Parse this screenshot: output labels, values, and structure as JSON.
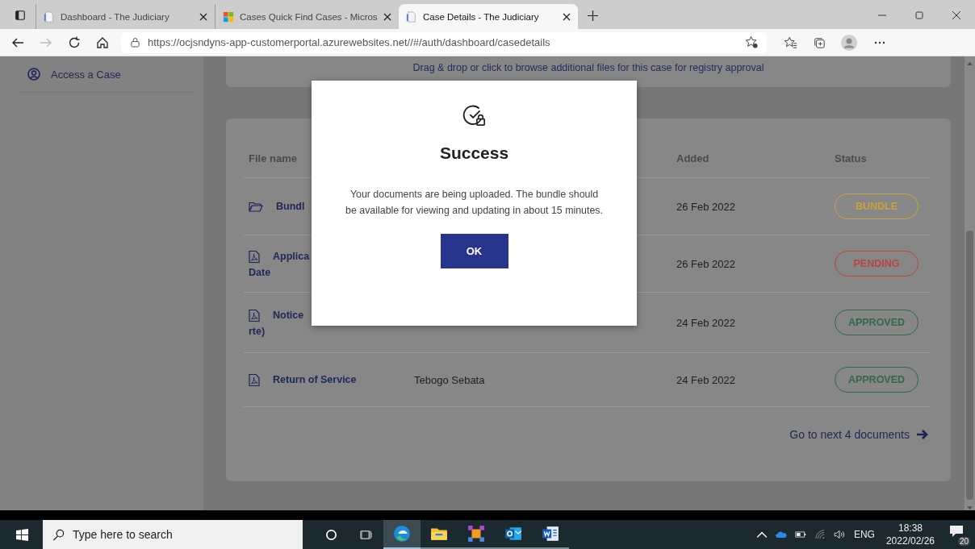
{
  "browser": {
    "tabs": [
      {
        "title": "Dashboard - The Judiciary",
        "kind": "page",
        "selected": false
      },
      {
        "title": "Cases Quick Find Cases - Micros",
        "kind": "windows",
        "selected": false
      },
      {
        "title": "Case Details - The Judiciary",
        "kind": "page",
        "selected": true
      }
    ],
    "forward_disabled": true,
    "address": "https://ocjsndyns-app-customerportal.azurewebsites.net//#/auth/dashboard/casedetails"
  },
  "sidebar": {
    "items": [
      {
        "label": "Access a Case"
      }
    ]
  },
  "upload_card": {
    "text": "Drag & drop or click to browse additional files for this case for registry approval"
  },
  "documents": {
    "columns": [
      {
        "label": "File name"
      },
      {
        "label": "Added"
      },
      {
        "label": "Status"
      }
    ],
    "rows": [
      {
        "kind": "folder",
        "name_lines": [
          "Bundl"
        ],
        "added": "26 Feb 2022",
        "status": "BUNDLE",
        "color": "#c9a43c"
      },
      {
        "kind": "pdf",
        "name_lines": [
          "Applica",
          "Date"
        ],
        "added": "26 Feb 2022",
        "status": "PENDING",
        "color": "#b8443c"
      },
      {
        "kind": "pdf",
        "name_lines": [
          "Notice",
          "rte)"
        ],
        "added": "24 Feb 2022",
        "status": "APPROVED",
        "color": "#2f6a48"
      },
      {
        "kind": "pdf",
        "name_lines": [
          "Return of Service"
        ],
        "uploaded_by": "Tebogo Sebata",
        "added": "24 Feb 2022",
        "status": "APPROVED",
        "color": "#2f6a48"
      }
    ],
    "next_link": "Go to next 4 documents"
  },
  "dialog": {
    "title": "Success",
    "message": "Your documents are being uploaded. The bundle should be available for viewing and updating in about 15 minutes.",
    "button": "OK"
  },
  "taskbar": {
    "search_placeholder": "Type here to search",
    "apps": [
      {
        "kind": "edge",
        "selected": true
      },
      {
        "kind": "explorer",
        "selected": false
      },
      {
        "kind": "puzzle",
        "selected": false
      },
      {
        "kind": "outlook",
        "selected": false
      },
      {
        "kind": "word",
        "selected": false
      }
    ],
    "language": "ENG",
    "time": "18:38",
    "date": "2022/02/26",
    "notifications": "20"
  }
}
